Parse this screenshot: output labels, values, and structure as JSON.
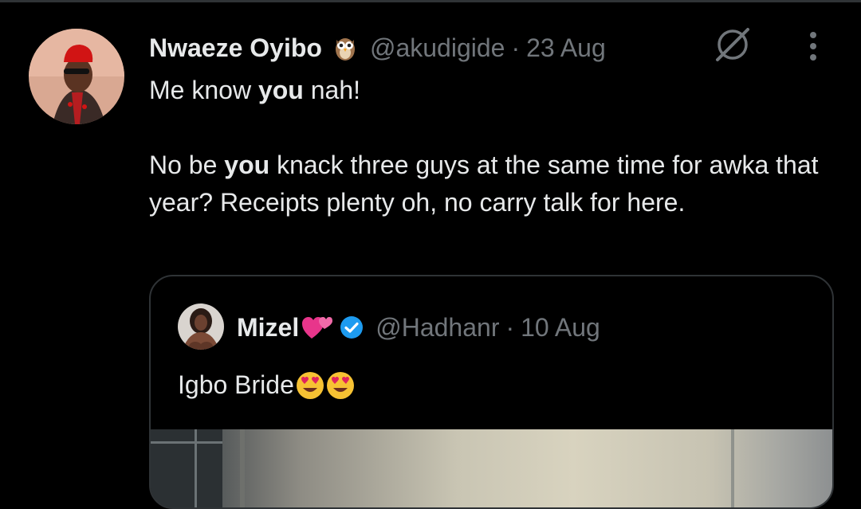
{
  "tweet": {
    "author_name": "Nwaeze Oyibo",
    "handle": "@akudigide",
    "separator": "·",
    "date": "23 Aug",
    "line1_pre": "Me know ",
    "line1_bold": "you",
    "line1_post": " nah!",
    "line2_pre": "No be ",
    "line2_bold": "you",
    "line2_post": " knack three guys at the same time for awka that year? Receipts plenty oh, no carry talk for here."
  },
  "quoted_tweet": {
    "author_name": "Mizel",
    "handle": "@Hadhanr",
    "separator": "·",
    "date": "10 Aug",
    "text": "Igbo Bride"
  },
  "icons": {
    "owl_badge": "owl-emoji-icon",
    "grok": "grok-icon",
    "more": "more-vertical-icon",
    "heart": "two-hearts-emoji-icon",
    "verified": "verified-badge-icon",
    "emoji": "heart-eyes-emoji-icon"
  },
  "colors": {
    "background": "#000000",
    "text": "#e7e9ea",
    "secondary_text": "#71767b",
    "border": "#2f3336",
    "verified_blue": "#1d9bf0"
  }
}
